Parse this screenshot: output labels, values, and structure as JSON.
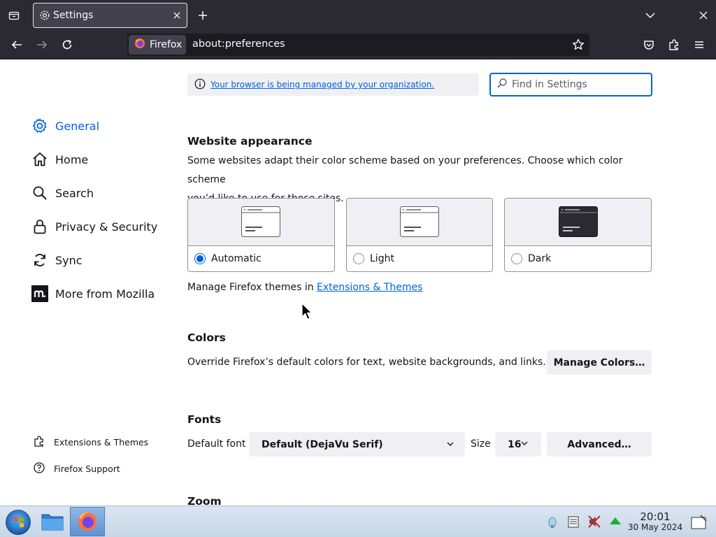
{
  "browser": {
    "tab_title": "Settings",
    "identity_label": "Firefox",
    "url": "about:preferences"
  },
  "sidebar": {
    "items": [
      {
        "label": "General"
      },
      {
        "label": "Home"
      },
      {
        "label": "Search"
      },
      {
        "label": "Privacy & Security"
      },
      {
        "label": "Sync"
      },
      {
        "label": "More from Mozilla"
      }
    ],
    "footer": [
      {
        "label": "Extensions & Themes"
      },
      {
        "label": "Firefox Support"
      }
    ]
  },
  "policy": {
    "text": "Your browser is being managed by your organization."
  },
  "search": {
    "placeholder": "Find in Settings"
  },
  "website_appearance": {
    "heading": "Website appearance",
    "description_line1": "Some websites adapt their color scheme based on your preferences. Choose which color scheme",
    "description_line2": "you’d like to use for those sites.",
    "options": [
      {
        "label": "Automatic",
        "selected": true
      },
      {
        "label": "Light",
        "selected": false
      },
      {
        "label": "Dark",
        "selected": false
      }
    ],
    "themes_prefix": "Manage Firefox themes in ",
    "themes_link": "Extensions & Themes"
  },
  "colors": {
    "heading": "Colors",
    "description": "Override Firefox’s default colors for text, website backgrounds, and links.",
    "button": "Manage Colors…"
  },
  "fonts": {
    "heading": "Fonts",
    "default_font_label": "Default font",
    "default_font_value": "Default (DejaVu Serif)",
    "size_label": "Size",
    "size_value": "16",
    "advanced_button": "Advanced…"
  },
  "zoom": {
    "heading": "Zoom"
  },
  "taskbar": {
    "time": "20:01",
    "date": "30 May 2024"
  },
  "colors_theme": {
    "accent": "#0061e0",
    "chrome_bg": "#2b2a33"
  }
}
